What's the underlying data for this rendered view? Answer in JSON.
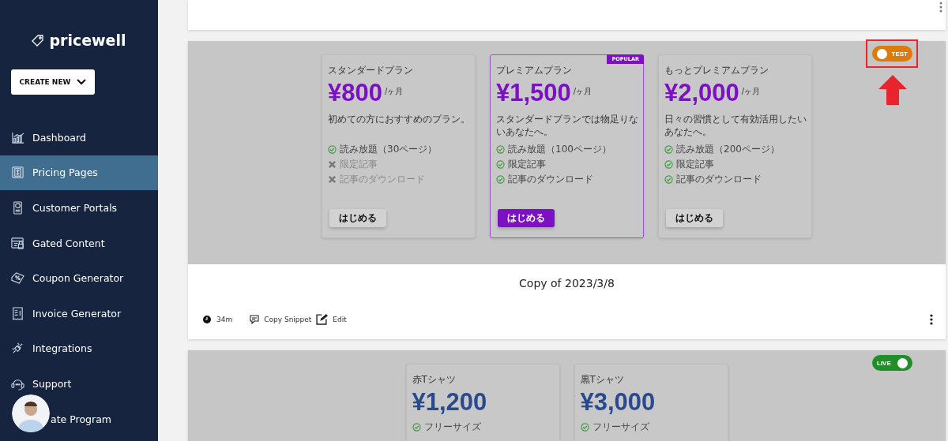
{
  "sidebar": {
    "logo": "pricewell",
    "create_button": "CREATE NEW",
    "items": [
      {
        "label": "Dashboard",
        "selected": false
      },
      {
        "label": "Pricing Pages",
        "selected": true
      },
      {
        "label": "Customer Portals",
        "selected": false
      },
      {
        "label": "Gated Content",
        "selected": false
      },
      {
        "label": "Coupon Generator",
        "selected": false
      },
      {
        "label": "Invoice Generator",
        "selected": false
      },
      {
        "label": "Integrations",
        "selected": false
      },
      {
        "label": "Support",
        "selected": false
      }
    ],
    "covered_item": {
      "label": "ate Program"
    }
  },
  "pages": [
    {
      "live": false,
      "toggle_label": "TEST",
      "highlighted_toggle": true,
      "color": "#7b10c4",
      "title": "Copy of 2023/3/8",
      "footer": {
        "age": "34m",
        "copy": "Copy Snippet",
        "edit": "Edit"
      },
      "plans": [
        {
          "name": "スタンダードプラン",
          "price": "¥800",
          "period": "/ヶ月",
          "description": "初めての方におすすめのプラン。",
          "highlighted": false,
          "button": "はじめる",
          "features": [
            {
              "text": "読み放題（30ページ）",
              "included": true
            },
            {
              "text": "限定記事",
              "included": false
            },
            {
              "text": "記事のダウンロード",
              "included": false
            }
          ]
        },
        {
          "name": "プレミアムプラン",
          "price": "¥1,500",
          "period": "/ヶ月",
          "description": "スタンダードプランでは物足りないあなたへ。",
          "highlighted": true,
          "badge": "POPULAR",
          "button": "はじめる",
          "features": [
            {
              "text": "読み放題（100ページ）",
              "included": true
            },
            {
              "text": "限定記事",
              "included": true
            },
            {
              "text": "記事のダウンロード",
              "included": true
            }
          ]
        },
        {
          "name": "もっとプレミアムプラン",
          "price": "¥2,000",
          "period": "/ヶ月",
          "description": "日々の習慣として有効活用したいあなたへ。",
          "highlighted": false,
          "button": "はじめる",
          "features": [
            {
              "text": "読み放題（200ページ）",
              "included": true
            },
            {
              "text": "限定記事",
              "included": true
            },
            {
              "text": "記事のダウンロード",
              "included": true
            }
          ]
        }
      ]
    },
    {
      "live": true,
      "toggle_label": "LIVE",
      "highlighted_toggle": false,
      "color": "#2a4a90",
      "plans": [
        {
          "name": "赤Tシャツ",
          "price": "¥1,200",
          "highlighted": false,
          "features": [
            {
              "text": "フリーサイズ",
              "included": true
            }
          ]
        },
        {
          "name": "黒Tシャツ",
          "price": "¥3,000",
          "highlighted": false,
          "features": [
            {
              "text": "フリーサイズ",
              "included": true
            }
          ]
        }
      ]
    }
  ]
}
